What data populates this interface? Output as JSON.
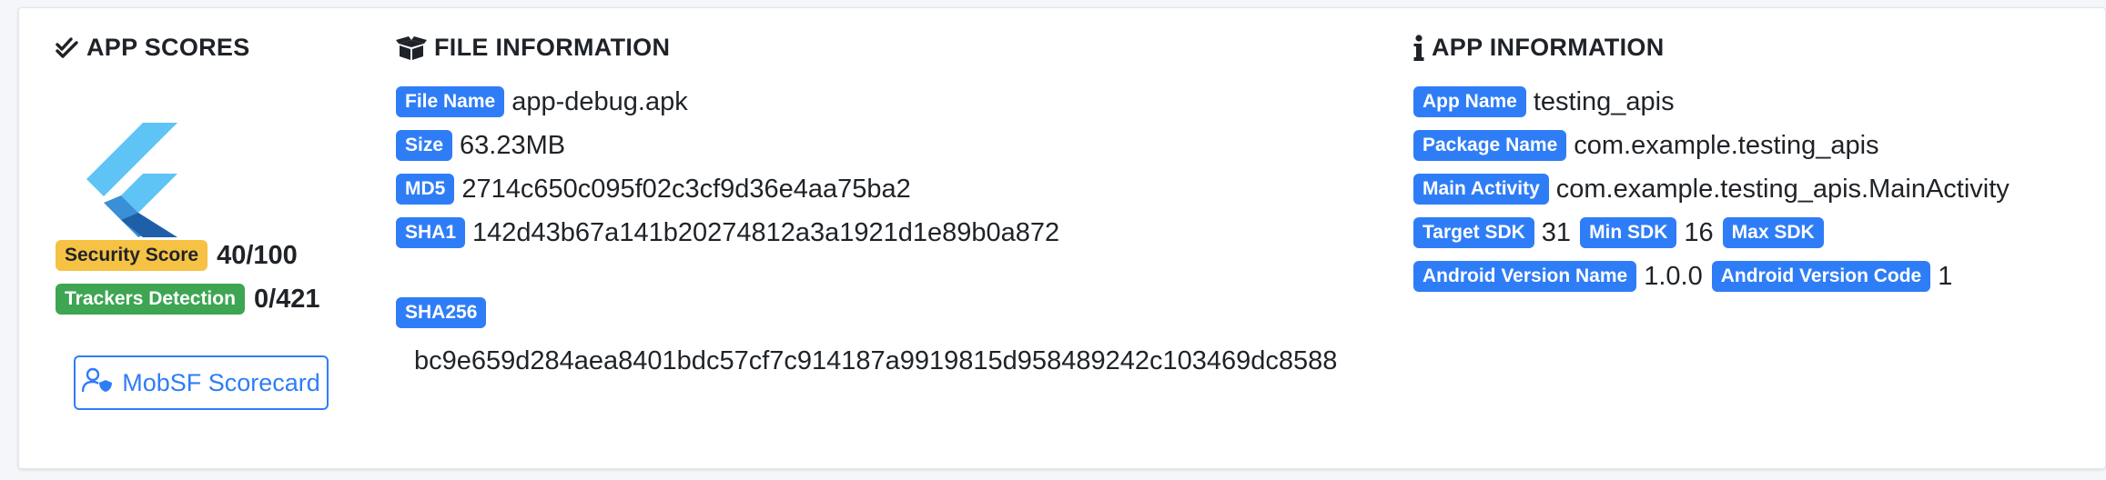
{
  "app_scores": {
    "title": "APP SCORES",
    "security_score_label": "Security Score",
    "security_score_value": "40/100",
    "trackers_label": "Trackers Detection",
    "trackers_value": "0/421",
    "scorecard_button": "MobSF Scorecard"
  },
  "file_info": {
    "title": "FILE INFORMATION",
    "file_name_label": "File Name",
    "file_name": "app-debug.apk",
    "size_label": "Size",
    "size": "63.23MB",
    "md5_label": "MD5",
    "md5": "2714c650c095f02c3cf9d36e4aa75ba2",
    "sha1_label": "SHA1",
    "sha1": "142d43b67a141b20274812a3a1921d1e89b0a872",
    "sha256_label": "SHA256",
    "sha256": "bc9e659d284aea8401bdc57cf7c914187a9919815d958489242c103469dc8588"
  },
  "app_info": {
    "title": "APP INFORMATION",
    "app_name_label": "App Name",
    "app_name": "testing_apis",
    "package_name_label": "Package Name",
    "package_name": "com.example.testing_apis",
    "main_activity_label": "Main Activity",
    "main_activity": "com.example.testing_apis.MainActivity",
    "target_sdk_label": "Target SDK",
    "target_sdk": "31",
    "min_sdk_label": "Min SDK",
    "min_sdk": "16",
    "max_sdk_label": "Max SDK",
    "version_name_label": "Android Version Name",
    "version_name": "1.0.0",
    "version_code_label": "Android Version Code",
    "version_code": "1"
  },
  "colors": {
    "badge_primary": "#2f7df6",
    "badge_warning": "#f6c244",
    "badge_success": "#3ea553",
    "flutter_light": "#5ec4f5",
    "flutter_dark": "#1f5fa8"
  },
  "icons": {
    "app_scores": "double-check-icon",
    "file_information": "box-open-icon",
    "app_information": "info-icon",
    "scorecard": "user-shield-icon",
    "app_logo": "flutter-logo"
  }
}
